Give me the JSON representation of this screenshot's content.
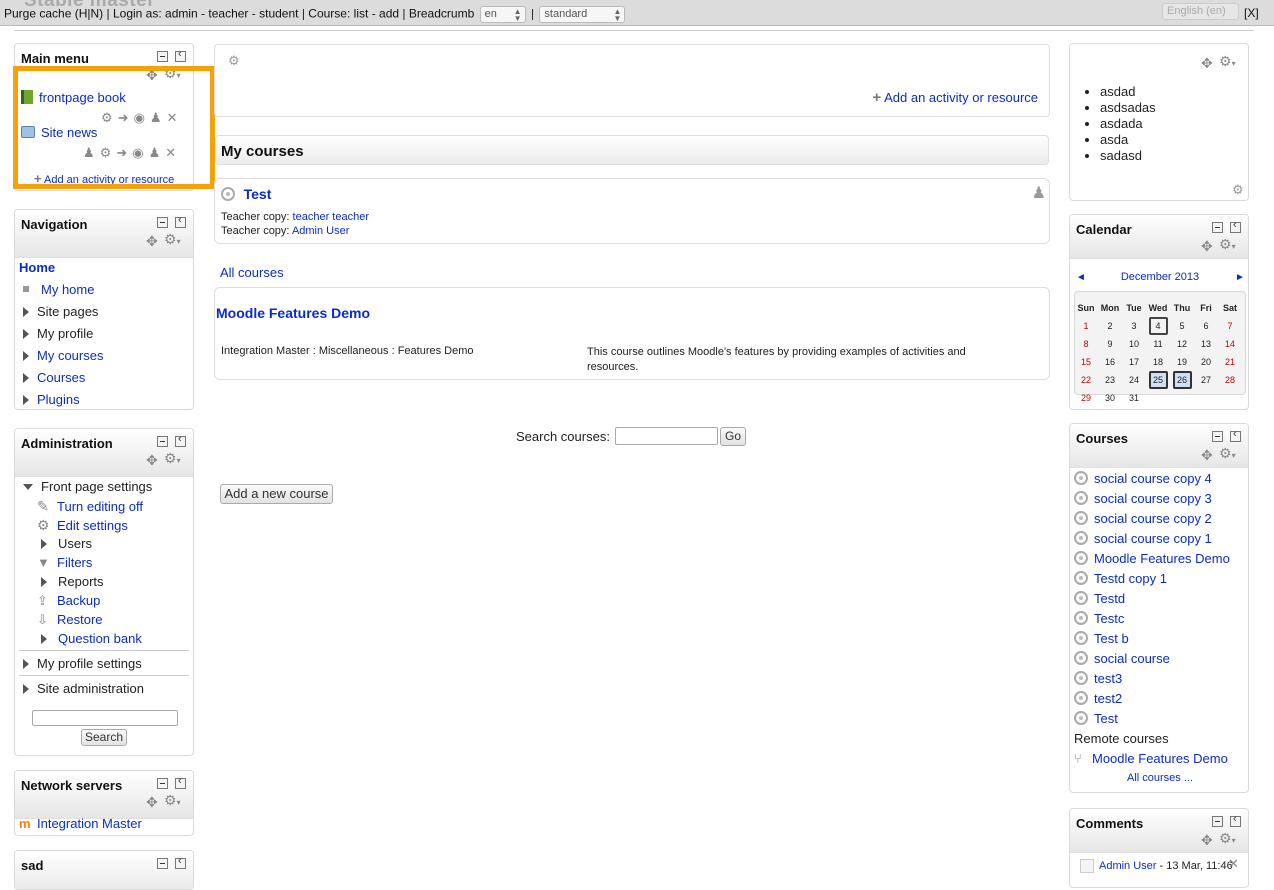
{
  "topbar": {
    "site_title": "Stable master",
    "purge": "Purge cache (H|N)",
    "sep1": "|",
    "login_as": "Login as:",
    "login_admin": "admin",
    "login_teacher": "teacher",
    "login_student": "student",
    "dash": "-",
    "sep2": "|",
    "course_label": "Course:",
    "course_list": "list",
    "course_add": "add",
    "sep3": "|",
    "breadcrumb": "Breadcrumb",
    "lang_select": "en",
    "sep4": "|",
    "theme_select": "standard",
    "lang_right": "English (en)",
    "close": "[X]"
  },
  "main_menu": {
    "title": "Main menu",
    "items": [
      {
        "label": "frontpage book"
      },
      {
        "label": "Site news"
      }
    ],
    "add_activity": "Add an activity or resource"
  },
  "navigation": {
    "title": "Navigation",
    "home": "Home",
    "items": [
      {
        "label": "My home",
        "link": true
      },
      {
        "label": "Site pages",
        "link": false
      },
      {
        "label": "My profile",
        "link": false
      },
      {
        "label": "My courses",
        "link": true
      },
      {
        "label": "Courses",
        "link": true
      },
      {
        "label": "Plugins",
        "link": true
      }
    ]
  },
  "administration": {
    "title": "Administration",
    "front_page_settings": "Front page settings",
    "items": [
      {
        "label": "Turn editing off",
        "icon": "pencil-icon",
        "link": true
      },
      {
        "label": "Edit settings",
        "icon": "gear-icon",
        "link": true
      },
      {
        "label": "Users",
        "icon": "expand-arrow-icon",
        "link": false
      },
      {
        "label": "Filters",
        "icon": "funnel-icon",
        "link": true
      },
      {
        "label": "Reports",
        "icon": "expand-arrow-icon",
        "link": false
      },
      {
        "label": "Backup",
        "icon": "backup-icon",
        "link": true
      },
      {
        "label": "Restore",
        "icon": "restore-icon",
        "link": true
      },
      {
        "label": "Question bank",
        "icon": "expand-arrow-icon",
        "link": true
      }
    ],
    "my_profile_settings": "My profile settings",
    "site_administration": "Site administration",
    "search_button": "Search"
  },
  "network_servers": {
    "title": "Network servers",
    "item": "Integration Master"
  },
  "sad_block": {
    "title": "sad"
  },
  "center": {
    "add_activity": "Add an activity or resource",
    "my_courses_title": "My courses",
    "course_name": "Test",
    "teacher1_label": "Teacher copy:",
    "teacher1_name": "teacher teacher",
    "teacher2_label": "Teacher copy:",
    "teacher2_name": "Admin User",
    "all_courses": "All courses",
    "featured_title": "Moodle Features Demo",
    "featured_category": "Integration Master : Miscellaneous : Features Demo",
    "featured_summary": "This course outlines Moodle's features by providing examples of activities and resources.",
    "search_label": "Search courses:",
    "go_button": "Go",
    "add_course_button": "Add a new course"
  },
  "right_list_block": {
    "items": [
      "asdad",
      "asdsadas",
      "asdada",
      "asda",
      "sadasd"
    ]
  },
  "calendar": {
    "title": "Calendar",
    "prev": "◄",
    "next": "►",
    "month": "December 2013",
    "days": [
      "Sun",
      "Mon",
      "Tue",
      "Wed",
      "Thu",
      "Fri",
      "Sat"
    ],
    "weeks": [
      [
        "1",
        "2",
        "3",
        "4",
        "5",
        "6",
        "7"
      ],
      [
        "8",
        "9",
        "10",
        "11",
        "12",
        "13",
        "14"
      ],
      [
        "15",
        "16",
        "17",
        "18",
        "19",
        "20",
        "21"
      ],
      [
        "22",
        "23",
        "24",
        "25",
        "26",
        "27",
        "28"
      ],
      [
        "29",
        "30",
        "31",
        "",
        "",
        "",
        ""
      ]
    ],
    "today": "4",
    "event_days": [
      "25",
      "26"
    ]
  },
  "courses_block": {
    "title": "Courses",
    "items": [
      "social course copy 4",
      "social course copy 3",
      "social course copy 2",
      "social course copy 1",
      "Moodle Features Demo",
      "Testd copy 1",
      "Testd",
      "Testc",
      "Test b",
      "social course",
      "test3",
      "test2",
      "Test"
    ],
    "remote_label": "Remote courses",
    "remote_item": "Moodle Features Demo",
    "all_courses": "All courses ..."
  },
  "comments_block": {
    "title": "Comments",
    "author": "Admin User",
    "date": "- 13 Mar, 11:46"
  },
  "colors": {
    "link": "#0a2bcc",
    "highlight": "#f5a20a",
    "weekend": "#cc0000"
  }
}
